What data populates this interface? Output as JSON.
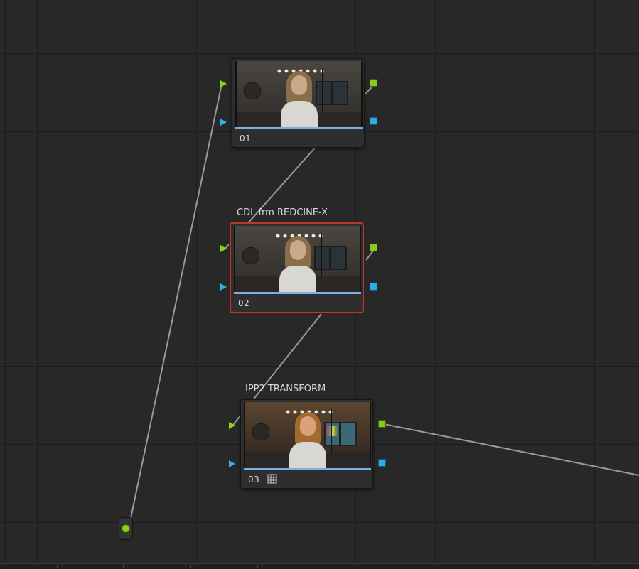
{
  "nodes": [
    {
      "label": "01",
      "title": ""
    },
    {
      "label": "02",
      "title": "CDL frm REDCINE-X",
      "selected": true
    },
    {
      "label": "03",
      "title": "IPP2 TRANSFORM",
      "has_grid_icon": true
    }
  ],
  "colors": {
    "background": "#282828",
    "rgb_port": "#8fd218",
    "alpha_port": "#2fb2ec",
    "selected_border": "#b33a2e",
    "link": "#9a9a9a"
  },
  "icons": [
    "grid-icon",
    "source-input-dot"
  ]
}
